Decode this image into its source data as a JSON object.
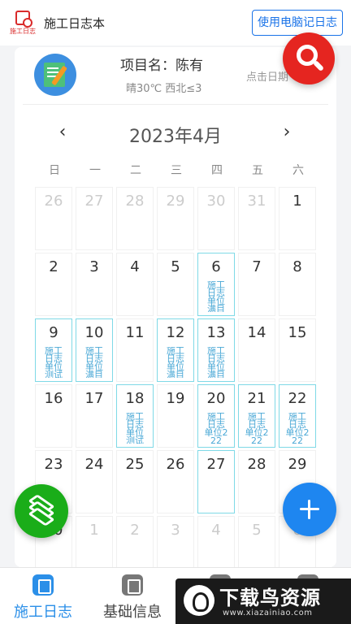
{
  "app": {
    "logo_text": "施工日志",
    "title": "施工日志本",
    "web_button": "使用电脑记日志"
  },
  "project": {
    "name": "项目名：陈有",
    "weather": "晴30℃ 西北≤3",
    "date_hint": "点击日期"
  },
  "calendar": {
    "month_title": "2023年4月",
    "prev": "‹",
    "next": "›",
    "weekdays": [
      "日",
      "一",
      "二",
      "三",
      "四",
      "五",
      "六"
    ],
    "cells": [
      {
        "day": "26",
        "other": true,
        "note": ""
      },
      {
        "day": "27",
        "other": true,
        "note": ""
      },
      {
        "day": "28",
        "other": true,
        "note": ""
      },
      {
        "day": "29",
        "other": true,
        "note": ""
      },
      {
        "day": "30",
        "other": true,
        "note": ""
      },
      {
        "day": "31",
        "other": true,
        "note": ""
      },
      {
        "day": "1",
        "other": false,
        "note": ""
      },
      {
        "day": "2",
        "other": false,
        "note": ""
      },
      {
        "day": "3",
        "other": false,
        "note": ""
      },
      {
        "day": "4",
        "other": false,
        "note": ""
      },
      {
        "day": "5",
        "other": false,
        "note": ""
      },
      {
        "day": "6",
        "other": false,
        "note": "施工日志单位满目",
        "logged": true
      },
      {
        "day": "7",
        "other": false,
        "note": ""
      },
      {
        "day": "8",
        "other": false,
        "note": ""
      },
      {
        "day": "9",
        "other": false,
        "note": "施工日志单位测试",
        "logged": true
      },
      {
        "day": "10",
        "other": false,
        "note": "施工日志单位满目",
        "logged": true
      },
      {
        "day": "11",
        "other": false,
        "note": ""
      },
      {
        "day": "12",
        "other": false,
        "note": "施工日志单位满目",
        "logged": true
      },
      {
        "day": "13",
        "other": false,
        "note": "施工日志单位满目",
        "logged": true
      },
      {
        "day": "14",
        "other": false,
        "note": ""
      },
      {
        "day": "15",
        "other": false,
        "note": ""
      },
      {
        "day": "16",
        "other": false,
        "note": ""
      },
      {
        "day": "17",
        "other": false,
        "note": ""
      },
      {
        "day": "18",
        "other": false,
        "note": "施工日志单位测试",
        "logged": true
      },
      {
        "day": "19",
        "other": false,
        "note": ""
      },
      {
        "day": "20",
        "other": false,
        "note": "施工日志单位222",
        "logged": true
      },
      {
        "day": "21",
        "other": false,
        "note": "施工日志单位222",
        "logged": true
      },
      {
        "day": "22",
        "other": false,
        "note": "施工日志单位222",
        "logged": true
      },
      {
        "day": "23",
        "other": false,
        "note": ""
      },
      {
        "day": "24",
        "other": false,
        "note": ""
      },
      {
        "day": "25",
        "other": false,
        "note": ""
      },
      {
        "day": "26",
        "other": false,
        "note": ""
      },
      {
        "day": "27",
        "other": false,
        "note": "",
        "logged": true
      },
      {
        "day": "28",
        "other": false,
        "note": ""
      },
      {
        "day": "29",
        "other": false,
        "note": ""
      },
      {
        "day": "30",
        "other": false,
        "note": ""
      },
      {
        "day": "1",
        "other": true,
        "note": ""
      },
      {
        "day": "2",
        "other": true,
        "note": ""
      },
      {
        "day": "3",
        "other": true,
        "note": ""
      },
      {
        "day": "4",
        "other": true,
        "note": ""
      },
      {
        "day": "5",
        "other": true,
        "note": ""
      },
      {
        "day": "6",
        "other": true,
        "note": ""
      }
    ]
  },
  "bottom_nav": {
    "tabs": [
      {
        "label": "施工日志",
        "active": true
      },
      {
        "label": "基础信息",
        "active": false
      },
      {
        "label": "",
        "active": false
      },
      {
        "label": "",
        "active": false
      }
    ]
  },
  "watermark": {
    "title": "下载鸟资源",
    "url": "www.xiazainiao.com"
  },
  "colors": {
    "brand_red": "#e52520",
    "primary_blue": "#1e86f0",
    "green": "#1aad19",
    "log_cyan": "#7fd9e6"
  },
  "icons": [
    "search-icon",
    "layers-icon",
    "plus-icon",
    "notebook-icon",
    "log-tab-icon",
    "info-tab-icon"
  ]
}
